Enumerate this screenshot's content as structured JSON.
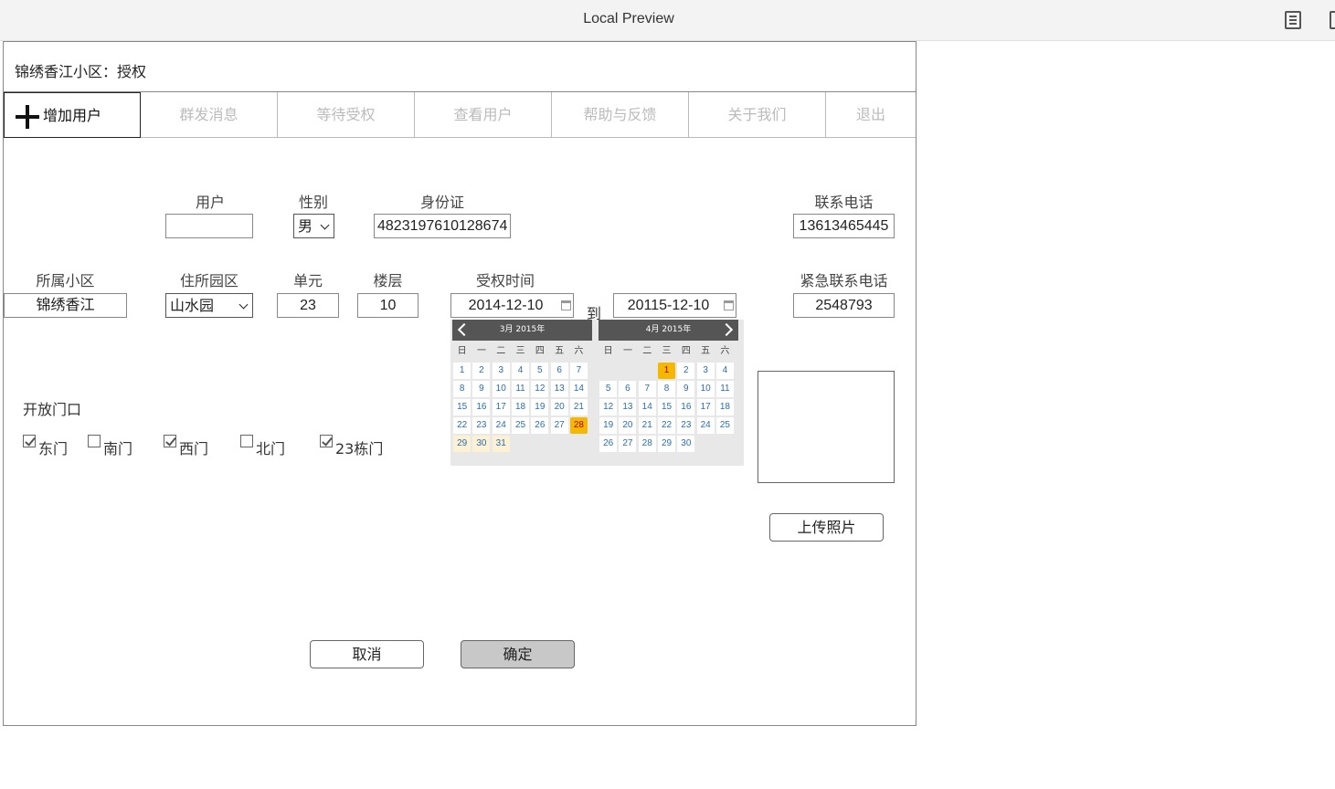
{
  "window": {
    "title": "Local Preview"
  },
  "header": {
    "text": "锦绣香江小区：授权"
  },
  "tabs": [
    {
      "label": "增加用户",
      "active": true
    },
    {
      "label": "群发消息"
    },
    {
      "label": "等待受权"
    },
    {
      "label": "查看用户"
    },
    {
      "label": "帮助与反馈"
    },
    {
      "label": "关于我们"
    },
    {
      "label": "退出"
    }
  ],
  "form": {
    "user": {
      "label": "用户",
      "value": ""
    },
    "gender": {
      "label": "性别",
      "value": "男"
    },
    "id_card": {
      "label": "身份证",
      "value": "4823197610128674"
    },
    "phone": {
      "label": "联系电话",
      "value": "13613465445"
    },
    "community": {
      "label": "所属小区",
      "value": "锦绣香江"
    },
    "garden": {
      "label": "住所园区",
      "value": "山水园"
    },
    "unit": {
      "label": "单元",
      "value": "23"
    },
    "floor": {
      "label": "楼层",
      "value": "10"
    },
    "auth_time": {
      "label": "受权时间",
      "from": "2014-12-10",
      "to_label": "到",
      "to": "20115-12-10"
    },
    "emergency_phone": {
      "label": "紧急联系电话",
      "value": "2548793"
    }
  },
  "calendar": {
    "weekdays": [
      "日",
      "一",
      "二",
      "三",
      "四",
      "五",
      "六"
    ],
    "months": [
      {
        "title": "3月 2015年",
        "offset": 0,
        "days": 31,
        "selected": 28,
        "highlight": [
          29,
          30,
          31
        ]
      },
      {
        "title": "4月 2015年",
        "offset": 3,
        "days": 30,
        "selected": 1,
        "highlight": []
      }
    ]
  },
  "gates": {
    "title": "开放门口",
    "items": [
      {
        "label": "东门",
        "checked": true
      },
      {
        "label": "南门",
        "checked": false
      },
      {
        "label": "西门",
        "checked": true
      },
      {
        "label": "北门",
        "checked": false
      },
      {
        "label": "23栋门",
        "checked": true
      }
    ]
  },
  "buttons": {
    "upload": "上传照片",
    "cancel": "取消",
    "confirm": "确定"
  }
}
